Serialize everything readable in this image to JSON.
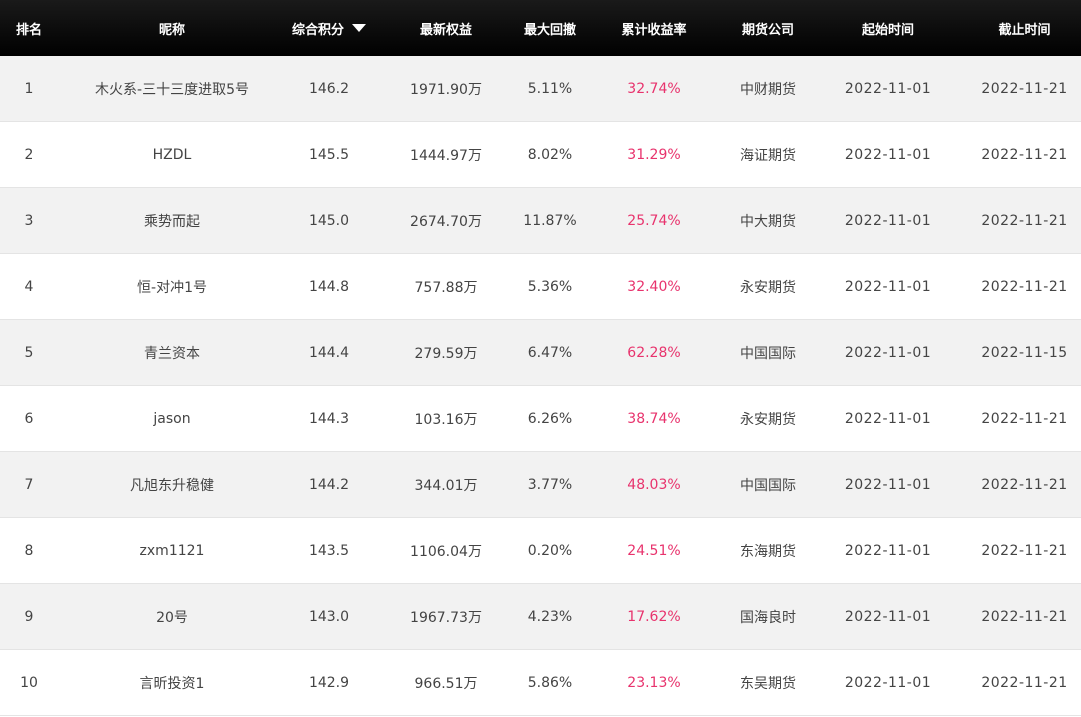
{
  "header": {
    "rank": "排名",
    "name": "昵称",
    "score": "综合积分",
    "equity": "最新权益",
    "max_drawdown": "最大回撤",
    "cum_return": "累计收益率",
    "company": "期货公司",
    "start": "起始时间",
    "end": "截止时间"
  },
  "rows": [
    {
      "rank": "1",
      "name": "木火系-三十三度进取5号",
      "score": "146.2",
      "equity": "1971.90万",
      "dd": "5.11%",
      "ret": "32.74%",
      "company": "中财期货",
      "start": "2022-11-01",
      "end": "2022-11-21"
    },
    {
      "rank": "2",
      "name": "HZDL",
      "score": "145.5",
      "equity": "1444.97万",
      "dd": "8.02%",
      "ret": "31.29%",
      "company": "海证期货",
      "start": "2022-11-01",
      "end": "2022-11-21"
    },
    {
      "rank": "3",
      "name": "乘势而起",
      "score": "145.0",
      "equity": "2674.70万",
      "dd": "11.87%",
      "ret": "25.74%",
      "company": "中大期货",
      "start": "2022-11-01",
      "end": "2022-11-21"
    },
    {
      "rank": "4",
      "name": "恒-对冲1号",
      "score": "144.8",
      "equity": "757.88万",
      "dd": "5.36%",
      "ret": "32.40%",
      "company": "永安期货",
      "start": "2022-11-01",
      "end": "2022-11-21"
    },
    {
      "rank": "5",
      "name": "青兰资本",
      "score": "144.4",
      "equity": "279.59万",
      "dd": "6.47%",
      "ret": "62.28%",
      "company": "中国国际",
      "start": "2022-11-01",
      "end": "2022-11-15"
    },
    {
      "rank": "6",
      "name": "jason",
      "score": "144.3",
      "equity": "103.16万",
      "dd": "6.26%",
      "ret": "38.74%",
      "company": "永安期货",
      "start": "2022-11-01",
      "end": "2022-11-21"
    },
    {
      "rank": "7",
      "name": "凡旭东升稳健",
      "score": "144.2",
      "equity": "344.01万",
      "dd": "3.77%",
      "ret": "48.03%",
      "company": "中国国际",
      "start": "2022-11-01",
      "end": "2022-11-21"
    },
    {
      "rank": "8",
      "name": "zxm1121",
      "score": "143.5",
      "equity": "1106.04万",
      "dd": "0.20%",
      "ret": "24.51%",
      "company": "东海期货",
      "start": "2022-11-01",
      "end": "2022-11-21"
    },
    {
      "rank": "9",
      "name": "20号",
      "score": "143.0",
      "equity": "1967.73万",
      "dd": "4.23%",
      "ret": "17.62%",
      "company": "国海良时",
      "start": "2022-11-01",
      "end": "2022-11-21"
    },
    {
      "rank": "10",
      "name": "言昕投资1",
      "score": "142.9",
      "equity": "966.51万",
      "dd": "5.86%",
      "ret": "23.13%",
      "company": "东吴期货",
      "start": "2022-11-01",
      "end": "2022-11-21"
    }
  ],
  "colors": {
    "header_bg": "#000000",
    "return_text": "#e8336d",
    "stripe": "#f2f2f2"
  },
  "icons": {
    "sort": "sort-descending-icon"
  }
}
